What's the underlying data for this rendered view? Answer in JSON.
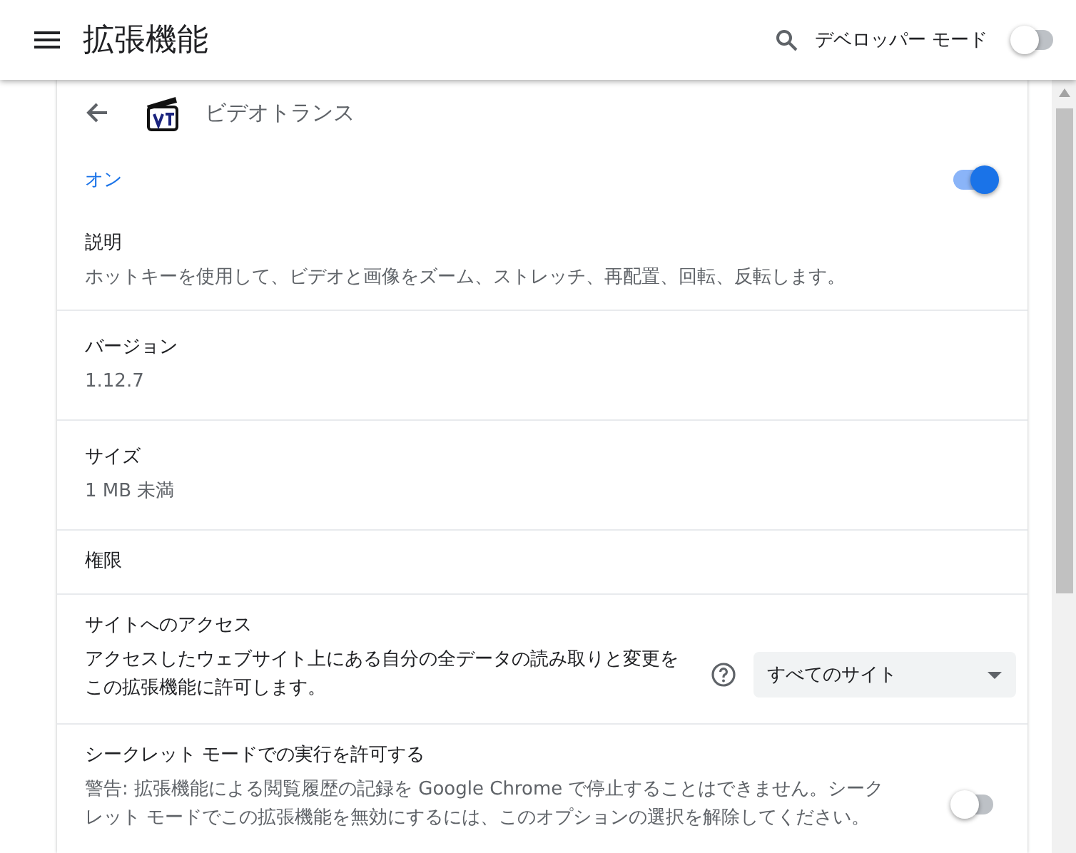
{
  "toolbar": {
    "title": "拡張機能",
    "developer_mode": {
      "label": "デベロッパー モード",
      "on": false
    }
  },
  "extension": {
    "name": "ビデオトランス",
    "enabled": {
      "label": "オン",
      "on": true
    }
  },
  "sections": [
    {
      "kind": "info",
      "label": "説明",
      "value": "ホットキーを使用して、ビデオと画像をズーム、ストレッチ、再配置、回転、反転します。"
    },
    {
      "kind": "info",
      "label": "バージョン",
      "value": "1.12.7"
    },
    {
      "kind": "info",
      "label": "サイズ",
      "value": "1 MB 未満"
    },
    {
      "kind": "heading",
      "label": "権限"
    },
    {
      "kind": "access",
      "label": "サイトへのアクセス",
      "value": "アクセスしたウェブサイト上にある自分の全データの読み取りと変更をこの拡張機能に許可します。",
      "select": "すべてのサイト"
    },
    {
      "kind": "toggle",
      "label": "シークレット モードでの実行を許可する",
      "value": "警告: 拡張機能による閲覧履歴の記録を Google Chrome で停止することはできません。シークレット モードでこの拡張機能を無効にするには、このオプションの選択を解除してください。",
      "on": false
    }
  ]
}
